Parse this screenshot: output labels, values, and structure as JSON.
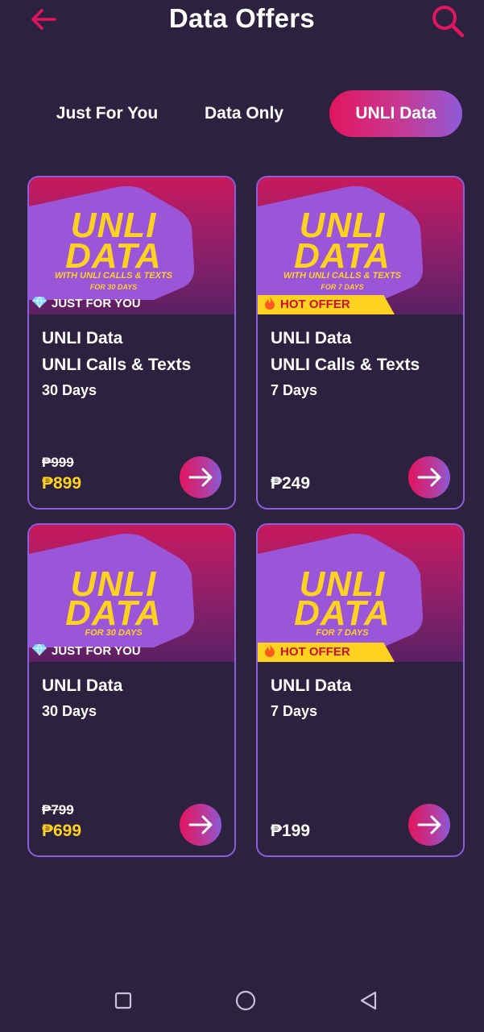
{
  "header": {
    "title": "Data Offers",
    "back_icon": "arrow-left-icon",
    "search_icon": "search-icon",
    "accent_color": "#e2155f"
  },
  "tabs": [
    {
      "label": "Just For You",
      "active": false
    },
    {
      "label": "Data Only",
      "active": false
    },
    {
      "label": "UNLI Data",
      "active": true
    }
  ],
  "offers": [
    {
      "banner": {
        "title1": "UNLI",
        "title2": "DATA",
        "subtitle": "WITH UNLI CALLS & TEXTS",
        "subtitle2": "FOR 30 DAYS"
      },
      "badge": "JUST FOR YOU",
      "line1": "UNLI Data",
      "line2": "UNLI Calls & Texts",
      "line3": "30 Days",
      "old_price": "₱999",
      "price": "₱899"
    },
    {
      "banner": {
        "title1": "UNLI",
        "title2": "DATA",
        "subtitle": "WITH UNLI CALLS & TEXTS",
        "subtitle2": "FOR 7 DAYS"
      },
      "badge": "HOT OFFER",
      "line1": "UNLI Data",
      "line2": "UNLI Calls & Texts",
      "line3": "7 Days",
      "price": "₱249"
    },
    {
      "banner": {
        "title1": "UNLI",
        "title2": "DATA",
        "subtitle": "FOR 30 DAYS"
      },
      "badge": "JUST FOR YOU",
      "line1": "UNLI Data",
      "line2": "30 Days",
      "old_price": "₱799",
      "price": "₱699"
    },
    {
      "banner": {
        "title1": "UNLI",
        "title2": "DATA",
        "subtitle": "FOR 7 DAYS"
      },
      "badge": "HOT OFFER",
      "line1": "UNLI Data",
      "line2": "7 Days",
      "price": "₱199"
    }
  ],
  "navbar": {
    "recents_icon": "square-icon",
    "home_icon": "circle-icon",
    "back_icon": "triangle-back-icon"
  },
  "colors": {
    "background": "#2d2140",
    "price_highlight": "#ffd21f",
    "card_border": "#8a5ed8",
    "hot_badge": "#ffd21f"
  }
}
